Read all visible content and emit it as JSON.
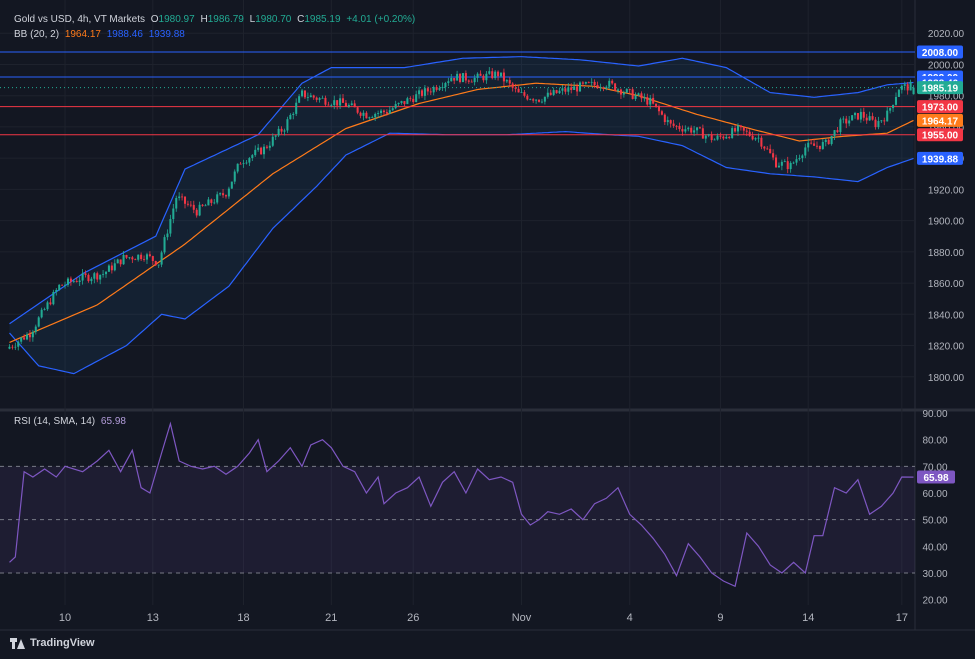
{
  "header": {
    "title": "Gold vs USD, 4h, VT Markets",
    "open_label": "O",
    "open": "1980.97",
    "high_label": "H",
    "high": "1986.79",
    "low_label": "L",
    "low": "1980.70",
    "close_label": "C",
    "close": "1985.19",
    "change": "+4.01 (+0.20%)"
  },
  "bb_legend": {
    "label": "BB (20, 2)",
    "basis": "1964.17",
    "upper": "1988.46",
    "lower": "1939.88"
  },
  "rsi_legend": {
    "label": "RSI (14, SMA, 14)",
    "value": "65.98"
  },
  "footer": {
    "brand": "TradingView"
  },
  "colors": {
    "background": "#131722",
    "up": "#22ab94",
    "down": "#f23645",
    "basis": "#ff7b1a",
    "bands": "#2962ff",
    "rsi": "#7e57c2",
    "resistance": "#2962ff",
    "support": "#f23645"
  },
  "chart_data": [
    {
      "type": "candlestick",
      "title": "Gold vs USD, 4h, VT Markets",
      "xlabel": "",
      "ylabel": "",
      "ylim": [
        1780,
        2024
      ],
      "yticks": [
        "2020.00",
        "2000.00",
        "1980.00",
        "1960.00",
        "1940.00",
        "1920.00",
        "1900.00",
        "1880.00",
        "1860.00",
        "1840.00",
        "1820.00",
        "1800.00"
      ],
      "xticks": [
        "10",
        "13",
        "18",
        "21",
        "26",
        "Nov",
        "4",
        "9",
        "14",
        "17"
      ],
      "xtick_index": [
        19,
        49,
        80,
        110,
        138,
        175,
        212,
        243,
        273,
        305
      ],
      "grid": true,
      "anchors": [
        [
          0,
          1818
        ],
        [
          8,
          1828
        ],
        [
          18,
          1858
        ],
        [
          25,
          1863
        ],
        [
          33,
          1866
        ],
        [
          40,
          1876
        ],
        [
          47,
          1878
        ],
        [
          52,
          1873
        ],
        [
          58,
          1915
        ],
        [
          65,
          1906
        ],
        [
          75,
          1918
        ],
        [
          80,
          1938
        ],
        [
          88,
          1946
        ],
        [
          95,
          1960
        ],
        [
          101,
          1981
        ],
        [
          107,
          1978
        ],
        [
          115,
          1975
        ],
        [
          123,
          1968
        ],
        [
          130,
          1970
        ],
        [
          138,
          1978
        ],
        [
          146,
          1985
        ],
        [
          152,
          1992
        ],
        [
          160,
          1991
        ],
        [
          168,
          1994
        ],
        [
          175,
          1981
        ],
        [
          182,
          1978
        ],
        [
          190,
          1983
        ],
        [
          197,
          1986
        ],
        [
          205,
          1988
        ],
        [
          212,
          1982
        ],
        [
          220,
          1976
        ],
        [
          227,
          1961
        ],
        [
          235,
          1958
        ],
        [
          242,
          1952
        ],
        [
          250,
          1958
        ],
        [
          257,
          1953
        ],
        [
          263,
          1937
        ],
        [
          268,
          1935
        ],
        [
          273,
          1947
        ],
        [
          280,
          1949
        ],
        [
          285,
          1962
        ],
        [
          292,
          1968
        ],
        [
          297,
          1962
        ],
        [
          301,
          1968
        ],
        [
          305,
          1985
        ],
        [
          309,
          1986
        ]
      ],
      "series": [
        {
          "name": "BB basis",
          "values": [
            [
              0,
              1822
            ],
            [
              30,
              1846
            ],
            [
              60,
              1885
            ],
            [
              90,
              1930
            ],
            [
              115,
              1959
            ],
            [
              140,
              1975
            ],
            [
              160,
              1984
            ],
            [
              180,
              1988
            ],
            [
              200,
              1986
            ],
            [
              215,
              1980
            ],
            [
              235,
              1968
            ],
            [
              255,
              1958
            ],
            [
              270,
              1951
            ],
            [
              285,
              1954
            ],
            [
              300,
              1956
            ],
            [
              309,
              1964.17
            ]
          ]
        },
        {
          "name": "BB upper",
          "values": [
            [
              0,
              1834
            ],
            [
              25,
              1866
            ],
            [
              50,
              1890
            ],
            [
              60,
              1933
            ],
            [
              85,
              1955
            ],
            [
              100,
              1988
            ],
            [
              110,
              1998
            ],
            [
              135,
              1998
            ],
            [
              155,
              2004
            ],
            [
              175,
              2005
            ],
            [
              195,
              2003
            ],
            [
              215,
              1999
            ],
            [
              230,
              2004
            ],
            [
              245,
              1998
            ],
            [
              260,
              1982
            ],
            [
              275,
              1979
            ],
            [
              290,
              1982
            ],
            [
              300,
              1987
            ],
            [
              309,
              1988.46
            ]
          ]
        },
        {
          "name": "BB lower",
          "values": [
            [
              0,
              1828
            ],
            [
              10,
              1807
            ],
            [
              22,
              1802
            ],
            [
              40,
              1820
            ],
            [
              52,
              1840
            ],
            [
              60,
              1837
            ],
            [
              75,
              1858
            ],
            [
              90,
              1895
            ],
            [
              105,
              1922
            ],
            [
              115,
              1942
            ],
            [
              130,
              1956
            ],
            [
              150,
              1955
            ],
            [
              170,
              1955
            ],
            [
              190,
              1957
            ],
            [
              205,
              1955
            ],
            [
              215,
              1954
            ],
            [
              230,
              1948
            ],
            [
              245,
              1934
            ],
            [
              260,
              1930
            ],
            [
              275,
              1928
            ],
            [
              290,
              1925
            ],
            [
              300,
              1934
            ],
            [
              309,
              1939.88
            ]
          ]
        }
      ],
      "last_candle": {
        "open": 1980.97,
        "high": 1986.79,
        "low": 1980.7,
        "close": 1985.19,
        "change": 4.01,
        "change_pct": 0.2
      },
      "levels": [
        {
          "price": 2008.0,
          "label": "2008.00",
          "kind": "resistance"
        },
        {
          "price": 1992.0,
          "label": "1992.00",
          "kind": "resistance"
        },
        {
          "price": 1973.0,
          "label": "1973.00",
          "kind": "support"
        },
        {
          "price": 1955.0,
          "label": "1955.00",
          "kind": "support"
        }
      ],
      "price_tags": [
        {
          "label": "2008.00",
          "price": 2008.0,
          "kind": "resistance"
        },
        {
          "label": "1992.00",
          "price": 1992.0,
          "kind": "resistance"
        },
        {
          "label": "1988.46",
          "price": 1988.46,
          "kind": "bands"
        },
        {
          "label": "1985.19",
          "price": 1985.19,
          "kind": "up"
        },
        {
          "label": "1973.00",
          "price": 1973.0,
          "kind": "support"
        },
        {
          "label": "1964.17",
          "price": 1964.17,
          "kind": "basis"
        },
        {
          "label": "1955.00",
          "price": 1955.0,
          "kind": "support"
        },
        {
          "label": "1939.88",
          "price": 1939.88,
          "kind": "bands"
        }
      ]
    },
    {
      "type": "line",
      "title": "RSI (14, SMA, 14)",
      "xlabel": "",
      "ylabel": "",
      "ylim": [
        18,
        90
      ],
      "yticks": [
        "90.00",
        "80.00",
        "70.00",
        "60.00",
        "50.00",
        "40.00",
        "30.00",
        "20.00"
      ],
      "bands": [
        70,
        50,
        30
      ],
      "series": [
        {
          "name": "RSI",
          "values": [
            [
              0,
              34
            ],
            [
              2,
              36
            ],
            [
              5,
              68
            ],
            [
              8,
              66
            ],
            [
              12,
              69
            ],
            [
              16,
              66
            ],
            [
              19,
              70
            ],
            [
              25,
              68
            ],
            [
              30,
              72
            ],
            [
              34,
              76
            ],
            [
              38,
              68
            ],
            [
              42,
              76
            ],
            [
              45,
              62
            ],
            [
              48,
              60
            ],
            [
              52,
              75
            ],
            [
              55,
              86
            ],
            [
              58,
              72
            ],
            [
              62,
              70
            ],
            [
              66,
              69
            ],
            [
              70,
              70
            ],
            [
              74,
              67
            ],
            [
              78,
              70
            ],
            [
              82,
              75
            ],
            [
              85,
              80
            ],
            [
              88,
              68
            ],
            [
              92,
              72
            ],
            [
              96,
              77
            ],
            [
              100,
              70
            ],
            [
              103,
              78
            ],
            [
              107,
              80
            ],
            [
              110,
              77
            ],
            [
              114,
              70
            ],
            [
              118,
              68
            ],
            [
              122,
              60
            ],
            [
              126,
              66
            ],
            [
              128,
              56
            ],
            [
              132,
              60
            ],
            [
              136,
              62
            ],
            [
              140,
              66
            ],
            [
              144,
              55
            ],
            [
              148,
              64
            ],
            [
              152,
              68
            ],
            [
              156,
              60
            ],
            [
              160,
              69
            ],
            [
              164,
              65
            ],
            [
              168,
              66
            ],
            [
              172,
              64
            ],
            [
              175,
              52
            ],
            [
              178,
              48
            ],
            [
              181,
              50
            ],
            [
              184,
              53
            ],
            [
              188,
              52
            ],
            [
              192,
              54
            ],
            [
              196,
              50
            ],
            [
              200,
              56
            ],
            [
              204,
              58
            ],
            [
              208,
              62
            ],
            [
              212,
              52
            ],
            [
              216,
              48
            ],
            [
              220,
              43
            ],
            [
              224,
              37
            ],
            [
              228,
              29
            ],
            [
              232,
              41
            ],
            [
              236,
              36
            ],
            [
              240,
              30
            ],
            [
              244,
              27
            ],
            [
              248,
              25
            ],
            [
              252,
              45
            ],
            [
              256,
              40
            ],
            [
              260,
              33
            ],
            [
              264,
              30
            ],
            [
              268,
              34
            ],
            [
              272,
              30
            ],
            [
              275,
              44
            ],
            [
              278,
              44
            ],
            [
              282,
              62
            ],
            [
              286,
              60
            ],
            [
              290,
              65
            ],
            [
              294,
              52
            ],
            [
              298,
              55
            ],
            [
              302,
              60
            ],
            [
              305,
              66
            ],
            [
              309,
              65.98
            ]
          ]
        }
      ],
      "last_value": 65.98
    }
  ]
}
